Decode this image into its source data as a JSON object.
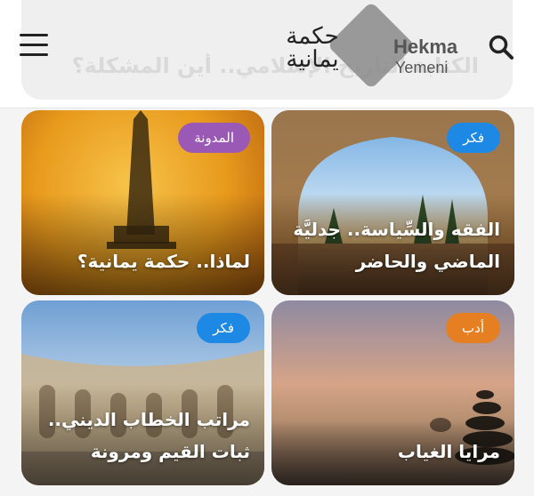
{
  "header": {
    "behind_title": "الكتابة التاريخ الإسلامي.. أين المشكلة؟",
    "logo": {
      "arabic_text": "حكمة يمانية",
      "english_line1": "Hekma",
      "english_line2": "Yemeni"
    },
    "menu_icon": "hamburger-menu-icon",
    "search_icon": "search-icon"
  },
  "colors": {
    "blue_badge": "#1e88e5",
    "purple_badge": "#9b59b6",
    "orange_badge": "#e67e22"
  },
  "cards": [
    {
      "badge": "فكر",
      "title": "الفقه والسِّياسة.. جدليَّة الماضي والحاضر"
    },
    {
      "badge": "المدونة",
      "title": "لماذا.. حكمة يمانية؟"
    },
    {
      "badge": "أدب",
      "title": "مرايا الغياب"
    },
    {
      "badge": "فكر",
      "title": "مراتب الخطاب الديني.. ثبات القيم ومرونة"
    }
  ]
}
